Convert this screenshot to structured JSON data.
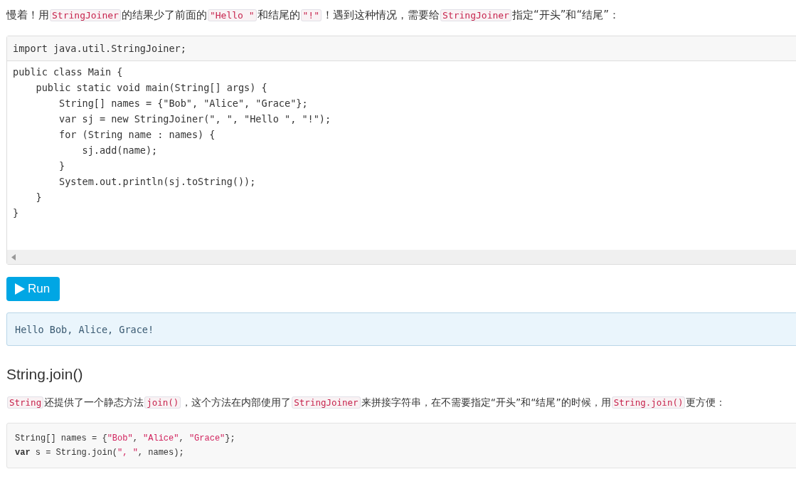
{
  "intro": {
    "segments": [
      {
        "kind": "text",
        "text": "慢着！用"
      },
      {
        "kind": "code",
        "text": "StringJoiner"
      },
      {
        "kind": "text",
        "text": "的结果少了前面的"
      },
      {
        "kind": "code",
        "text": "\"Hello \""
      },
      {
        "kind": "text",
        "text": "和结尾的"
      },
      {
        "kind": "code",
        "text": "\"!\""
      },
      {
        "kind": "text",
        "text": "！遇到这种情况，需要给"
      },
      {
        "kind": "code",
        "text": "StringJoiner"
      },
      {
        "kind": "text",
        "text": "指定“开头”和“结尾”："
      }
    ]
  },
  "editor": {
    "header_line": "import java.util.StringJoiner;",
    "lines": [
      "public class Main {",
      "    public static void main(String[] args) {",
      "        String[] names = {\"Bob\", \"Alice\", \"Grace\"};",
      "        var sj = new StringJoiner(\", \", \"Hello \", \"!\");",
      "        for (String name : names) {",
      "            sj.add(name);",
      "        }",
      "        System.out.println(sj.toString());",
      "    }",
      "}"
    ]
  },
  "run_button": {
    "label": "Run"
  },
  "output": "Hello Bob, Alice, Grace!",
  "heading": "String.join()",
  "paragraph": {
    "segments": [
      {
        "kind": "code",
        "text": "String"
      },
      {
        "kind": "text",
        "text": "还提供了一个静态方法"
      },
      {
        "kind": "code",
        "text": "join()"
      },
      {
        "kind": "text",
        "text": "，这个方法在内部使用了"
      },
      {
        "kind": "code",
        "text": "StringJoiner"
      },
      {
        "kind": "text",
        "text": "来拼接字符串，在不需要指定“开头”和“结尾”的时候，用"
      },
      {
        "kind": "code",
        "text": "String.join()"
      },
      {
        "kind": "text",
        "text": "更方便："
      }
    ]
  },
  "snippet": {
    "lines": [
      {
        "tokens": [
          {
            "kind": "plain",
            "text": "String[] names = {"
          },
          {
            "kind": "string",
            "text": "\"Bob\""
          },
          {
            "kind": "plain",
            "text": ", "
          },
          {
            "kind": "string",
            "text": "\"Alice\""
          },
          {
            "kind": "plain",
            "text": ", "
          },
          {
            "kind": "string",
            "text": "\"Grace\""
          },
          {
            "kind": "plain",
            "text": "};"
          }
        ]
      },
      {
        "tokens": [
          {
            "kind": "keyword",
            "text": "var"
          },
          {
            "kind": "plain",
            "text": " s = String.join("
          },
          {
            "kind": "string",
            "text": "\", \""
          },
          {
            "kind": "plain",
            "text": ", names);"
          }
        ]
      }
    ]
  }
}
